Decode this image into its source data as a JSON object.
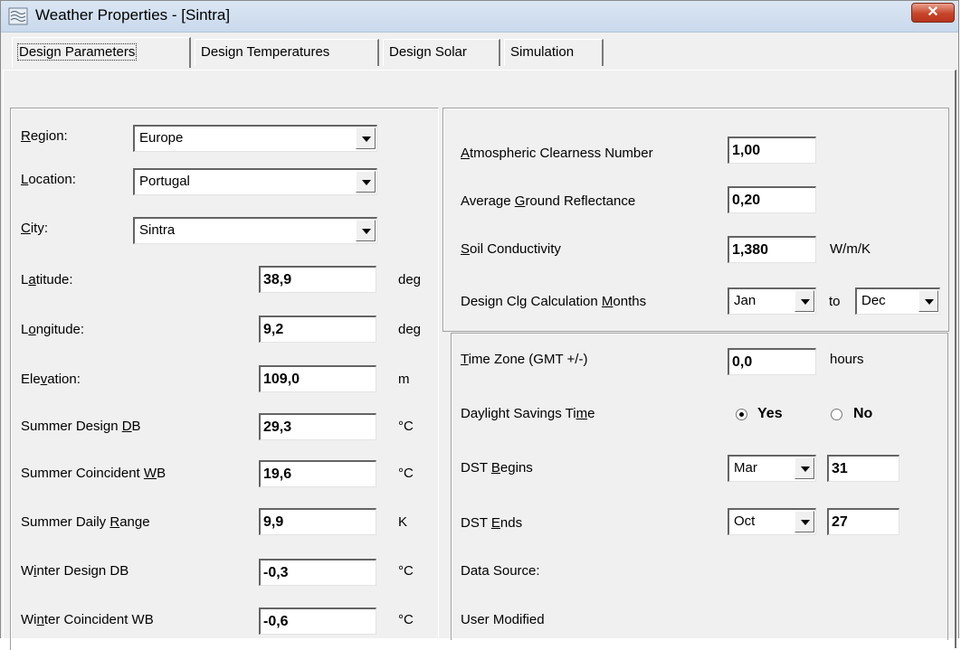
{
  "window": {
    "title": "Weather Properties - [Sintra]",
    "close_glyph": "✕",
    "icon": "weather-app-icon",
    "close_color": "#c7462a"
  },
  "tabs": [
    {
      "label": "Design Parameters",
      "active": true
    },
    {
      "label": "Design Temperatures"
    },
    {
      "label": "Design Solar"
    },
    {
      "label": "Simulation"
    }
  ],
  "left": {
    "region": {
      "label_u": "R",
      "label_rest": "egion:",
      "value": "Europe"
    },
    "location": {
      "label_u": "L",
      "label_rest": "ocation:",
      "value": "Portugal"
    },
    "city": {
      "label_u": "C",
      "label_rest": "ity:",
      "value": "Sintra"
    },
    "fields": [
      {
        "pre": "L",
        "u": "a",
        "post": "titude:",
        "value": "38,9",
        "unit": "deg"
      },
      {
        "pre": "L",
        "u": "o",
        "post": "ngitude:",
        "value": "9,2",
        "unit": "deg"
      },
      {
        "pre": "Ele",
        "u": "v",
        "post": "ation:",
        "value": "109,0",
        "unit": "m"
      },
      {
        "pre": "Summer Design ",
        "u": "D",
        "post": "B",
        "value": "29,3",
        "unit": "°C"
      },
      {
        "pre": "Summer Coincident ",
        "u": "W",
        "post": "B",
        "value": "19,6",
        "unit": "°C"
      },
      {
        "pre": "Summer Daily ",
        "u": "R",
        "post": "ange",
        "value": "9,9",
        "unit": "K"
      },
      {
        "pre": "W",
        "u": "i",
        "post": "nter Design DB",
        "value": "-0,3",
        "unit": "°C"
      },
      {
        "pre": "Wi",
        "u": "n",
        "post": "ter Coincident WB",
        "value": "-0,6",
        "unit": "°C"
      }
    ]
  },
  "right": {
    "clearness": {
      "u": "A",
      "rest": "tmospheric Clearness Number",
      "value": "1,00"
    },
    "reflectance": {
      "pre": "Average ",
      "u": "G",
      "post": "round Reflectance",
      "value": "0,20"
    },
    "soil": {
      "u": "S",
      "rest": "oil Conductivity",
      "value": "1,380",
      "unit": "W/m/K"
    },
    "months": {
      "pre": "Design Clg Calculation ",
      "u": "M",
      "post": "onths",
      "from": "Jan",
      "to_label": "to",
      "to": "Dec"
    },
    "timezone": {
      "u": "T",
      "rest": "ime Zone (GMT +/-)",
      "value": "0,0",
      "unit": "hours"
    },
    "dst": {
      "pre": "Daylight Savings Ti",
      "u": "m",
      "post": "e",
      "yes": "Yes",
      "no": "No",
      "selected": "Yes"
    },
    "dst_begins": {
      "pre": "DST ",
      "u": "B",
      "post": "egins",
      "month": "Mar",
      "day": "31"
    },
    "dst_ends": {
      "pre": "DST ",
      "u": "E",
      "post": "nds",
      "month": "Oct",
      "day": "27"
    },
    "data_source": "Data Source:",
    "user_modified": "User Modified"
  }
}
